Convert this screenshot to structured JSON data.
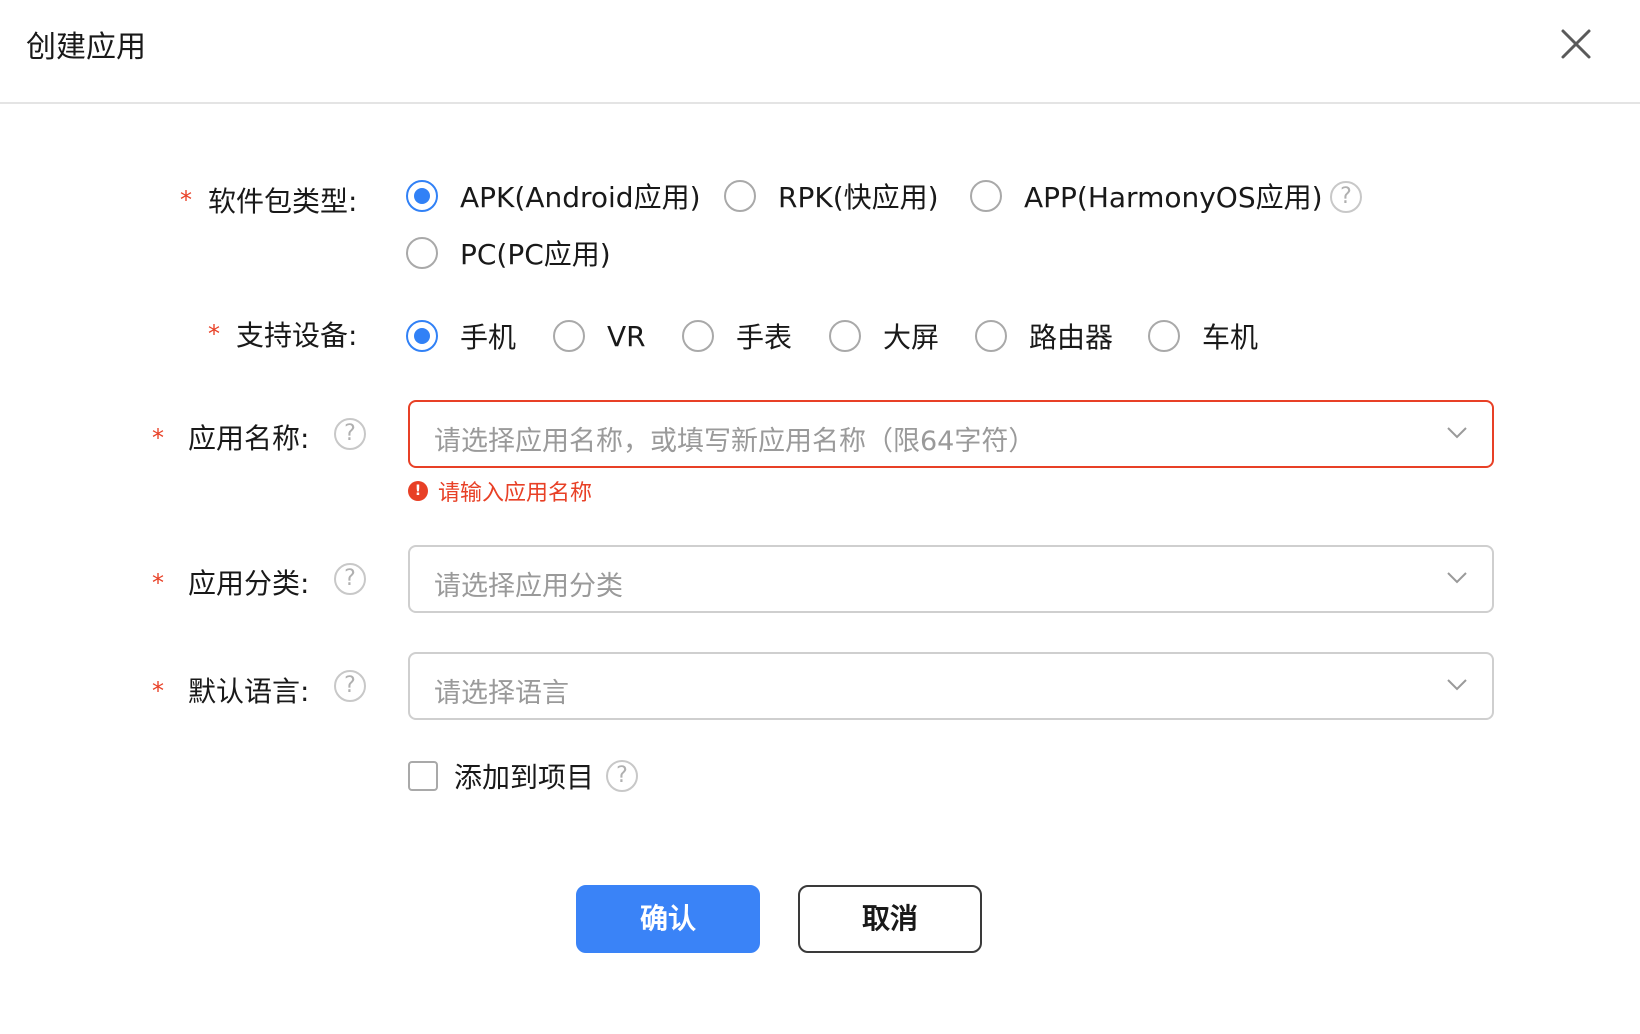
{
  "dialog": {
    "title": "创建应用",
    "close_icon": "close-icon"
  },
  "package_type": {
    "required_mark": "*",
    "label": "软件包类型:",
    "options": [
      {
        "label": "APK(Android应用)",
        "checked": true
      },
      {
        "label": "RPK(快应用)",
        "checked": false
      },
      {
        "label": "APP(HarmonyOS应用)",
        "checked": false
      },
      {
        "label": "PC(PC应用)",
        "checked": false
      }
    ],
    "help_icon": "question-circle-icon",
    "help_glyph": "?"
  },
  "devices": {
    "required_mark": "*",
    "label": "支持设备:",
    "options": [
      {
        "label": "手机",
        "checked": true
      },
      {
        "label": "VR",
        "checked": false
      },
      {
        "label": "手表",
        "checked": false
      },
      {
        "label": "大屏",
        "checked": false
      },
      {
        "label": "路由器",
        "checked": false
      },
      {
        "label": "车机",
        "checked": false
      }
    ]
  },
  "app_name": {
    "required_mark": "*",
    "label": "应用名称:",
    "help_glyph": "?",
    "placeholder": "请选择应用名称，或填写新应用名称（限64字符）",
    "error_glyph": "!",
    "error": "请输入应用名称"
  },
  "app_category": {
    "required_mark": "*",
    "label": "应用分类:",
    "help_glyph": "?",
    "placeholder": "请选择应用分类"
  },
  "default_language": {
    "required_mark": "*",
    "label": "默认语言:",
    "help_glyph": "?",
    "placeholder": "请选择语言"
  },
  "add_to_project": {
    "label": "添加到项目",
    "checked": false,
    "help_glyph": "?"
  },
  "buttons": {
    "confirm": "确认",
    "cancel": "取消"
  },
  "colors": {
    "accent": "#3a83f7",
    "error": "#e84026",
    "border": "#cfcfcf"
  }
}
